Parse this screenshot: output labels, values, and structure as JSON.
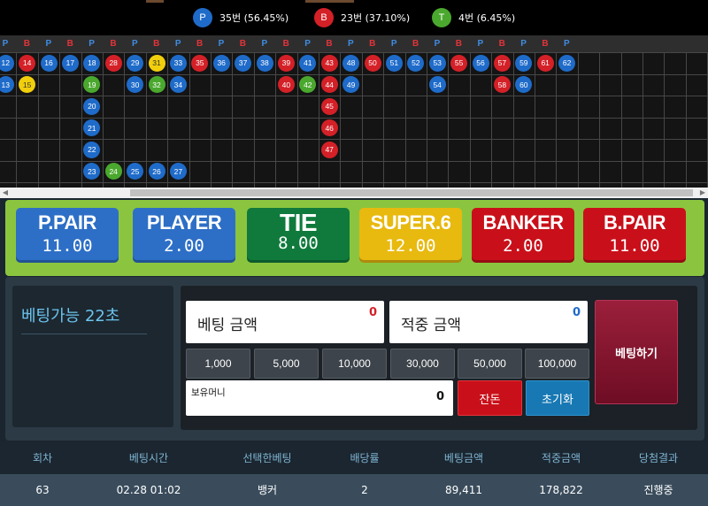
{
  "stats": [
    {
      "letter": "P",
      "text": "35번 (56.45%)",
      "color": "#1f6bc9"
    },
    {
      "letter": "B",
      "text": "23번 (37.10%)",
      "color": "#d42027"
    },
    {
      "letter": "T",
      "text": "4번 (6.45%)",
      "color": "#4aa82e"
    }
  ],
  "road": {
    "header": [
      "P",
      "B",
      "P",
      "B",
      "P",
      "B",
      "P",
      "B",
      "P",
      "B",
      "P",
      "B",
      "P",
      "B",
      "P",
      "B",
      "P",
      "B",
      "P",
      "B",
      "P",
      "B",
      "P",
      "B",
      "P",
      "B",
      "P"
    ],
    "beads": [
      {
        "c": 0,
        "r": 0,
        "n": "12",
        "t": "P"
      },
      {
        "c": 1,
        "r": 0,
        "n": "14",
        "t": "B"
      },
      {
        "c": 2,
        "r": 0,
        "n": "16",
        "t": "P"
      },
      {
        "c": 3,
        "r": 0,
        "n": "17",
        "t": "P"
      },
      {
        "c": 4,
        "r": 0,
        "n": "18",
        "t": "P"
      },
      {
        "c": 5,
        "r": 0,
        "n": "28",
        "t": "B"
      },
      {
        "c": 6,
        "r": 0,
        "n": "29",
        "t": "P"
      },
      {
        "c": 7,
        "r": 0,
        "n": "31",
        "t": "Y"
      },
      {
        "c": 8,
        "r": 0,
        "n": "33",
        "t": "P"
      },
      {
        "c": 9,
        "r": 0,
        "n": "35",
        "t": "B"
      },
      {
        "c": 10,
        "r": 0,
        "n": "36",
        "t": "P"
      },
      {
        "c": 11,
        "r": 0,
        "n": "37",
        "t": "P"
      },
      {
        "c": 12,
        "r": 0,
        "n": "38",
        "t": "P"
      },
      {
        "c": 13,
        "r": 0,
        "n": "39",
        "t": "B"
      },
      {
        "c": 14,
        "r": 0,
        "n": "41",
        "t": "P"
      },
      {
        "c": 15,
        "r": 0,
        "n": "43",
        "t": "B"
      },
      {
        "c": 16,
        "r": 0,
        "n": "48",
        "t": "P"
      },
      {
        "c": 17,
        "r": 0,
        "n": "50",
        "t": "B"
      },
      {
        "c": 18,
        "r": 0,
        "n": "51",
        "t": "P"
      },
      {
        "c": 19,
        "r": 0,
        "n": "52",
        "t": "P"
      },
      {
        "c": 20,
        "r": 0,
        "n": "53",
        "t": "P"
      },
      {
        "c": 21,
        "r": 0,
        "n": "55",
        "t": "B"
      },
      {
        "c": 22,
        "r": 0,
        "n": "56",
        "t": "P"
      },
      {
        "c": 23,
        "r": 0,
        "n": "57",
        "t": "B"
      },
      {
        "c": 24,
        "r": 0,
        "n": "59",
        "t": "P"
      },
      {
        "c": 25,
        "r": 0,
        "n": "61",
        "t": "B"
      },
      {
        "c": 26,
        "r": 0,
        "n": "62",
        "t": "P"
      },
      {
        "c": 0,
        "r": 1,
        "n": "13",
        "t": "P"
      },
      {
        "c": 1,
        "r": 1,
        "n": "15",
        "t": "Y"
      },
      {
        "c": 4,
        "r": 1,
        "n": "19",
        "t": "T"
      },
      {
        "c": 6,
        "r": 1,
        "n": "30",
        "t": "P"
      },
      {
        "c": 7,
        "r": 1,
        "n": "32",
        "t": "T"
      },
      {
        "c": 8,
        "r": 1,
        "n": "34",
        "t": "P"
      },
      {
        "c": 13,
        "r": 1,
        "n": "40",
        "t": "B"
      },
      {
        "c": 14,
        "r": 1,
        "n": "42",
        "t": "T"
      },
      {
        "c": 15,
        "r": 1,
        "n": "44",
        "t": "B"
      },
      {
        "c": 16,
        "r": 1,
        "n": "49",
        "t": "P"
      },
      {
        "c": 20,
        "r": 1,
        "n": "54",
        "t": "P"
      },
      {
        "c": 23,
        "r": 1,
        "n": "58",
        "t": "B"
      },
      {
        "c": 24,
        "r": 1,
        "n": "60",
        "t": "P"
      },
      {
        "c": 4,
        "r": 2,
        "n": "20",
        "t": "P"
      },
      {
        "c": 15,
        "r": 2,
        "n": "45",
        "t": "B"
      },
      {
        "c": 4,
        "r": 3,
        "n": "21",
        "t": "P"
      },
      {
        "c": 15,
        "r": 3,
        "n": "46",
        "t": "B"
      },
      {
        "c": 4,
        "r": 4,
        "n": "22",
        "t": "P"
      },
      {
        "c": 15,
        "r": 4,
        "n": "47",
        "t": "B"
      },
      {
        "c": 4,
        "r": 5,
        "n": "23",
        "t": "P"
      },
      {
        "c": 5,
        "r": 5,
        "n": "24",
        "t": "T"
      },
      {
        "c": 6,
        "r": 5,
        "n": "25",
        "t": "P"
      },
      {
        "c": 7,
        "r": 5,
        "n": "26",
        "t": "P"
      },
      {
        "c": 8,
        "r": 5,
        "n": "27",
        "t": "P"
      }
    ]
  },
  "bet_options": [
    {
      "name": "P.PAIR",
      "odds": "11.00",
      "color": "#2d6fc6"
    },
    {
      "name": "PLAYER",
      "odds": "2.00",
      "color": "#2d6fc6"
    },
    {
      "name": "TIE",
      "odds": "8.00",
      "color": "#0f7a3c"
    },
    {
      "name": "SUPER.6",
      "odds": "12.00",
      "color": "#e8b90f"
    },
    {
      "name": "BANKER",
      "odds": "2.00",
      "color": "#c9101a"
    },
    {
      "name": "B.PAIR",
      "odds": "11.00",
      "color": "#c9101a"
    }
  ],
  "panel": {
    "timer_text": "베팅가능 22초",
    "bet_amount_label": "베팅 금액",
    "bet_amount_value": "0",
    "win_amount_label": "적중 금액",
    "win_amount_value": "0",
    "chips": [
      "1,000",
      "5,000",
      "10,000",
      "30,000",
      "50,000",
      "100,000"
    ],
    "balance_label": "보유머니",
    "balance_value": "0",
    "change_label": "잔돈",
    "reset_label": "초기화",
    "place_bet_label": "베팅하기"
  },
  "history": {
    "columns": [
      "회차",
      "베팅시간",
      "선택한베팅",
      "배당률",
      "베팅금액",
      "적중금액",
      "당첨결과"
    ],
    "rows": [
      [
        "63",
        "02.28 01:02",
        "뱅커",
        "2",
        "89,411",
        "178,822",
        "진행중"
      ]
    ]
  },
  "colors": {
    "player": "#1f6bc9",
    "banker": "#d42027",
    "tie": "#4aa82e",
    "yellow": "#f2cf0c"
  }
}
